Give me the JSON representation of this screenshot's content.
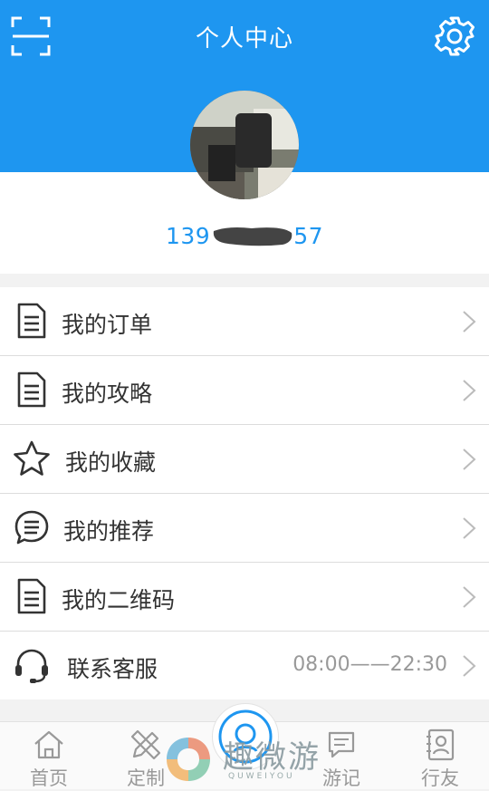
{
  "header": {
    "title": "个人中心"
  },
  "profile": {
    "phone_prefix": "139",
    "phone_suffix": "57"
  },
  "menu": [
    {
      "icon": "document-icon",
      "label": "我的订单"
    },
    {
      "icon": "document-icon",
      "label": "我的攻略"
    },
    {
      "icon": "star-icon",
      "label": "我的收藏"
    },
    {
      "icon": "chat-bubble-icon",
      "label": "我的推荐"
    },
    {
      "icon": "document-icon",
      "label": "我的二维码"
    },
    {
      "icon": "headset-icon",
      "label": "联系客服",
      "value": "08:00——22:30"
    }
  ],
  "tabbar": {
    "tabs": [
      {
        "icon": "home-icon",
        "label": "首页"
      },
      {
        "icon": "pencil-ruler-icon",
        "label": "定制"
      },
      {
        "icon": "chat-icon",
        "label": "游记"
      },
      {
        "icon": "contact-card-icon",
        "label": "行友"
      }
    ]
  },
  "watermark": {
    "text": "趣微游",
    "sub": "QUWEIYOU"
  },
  "colors": {
    "primary": "#1e96f0",
    "text": "#333333",
    "muted": "#999999"
  }
}
